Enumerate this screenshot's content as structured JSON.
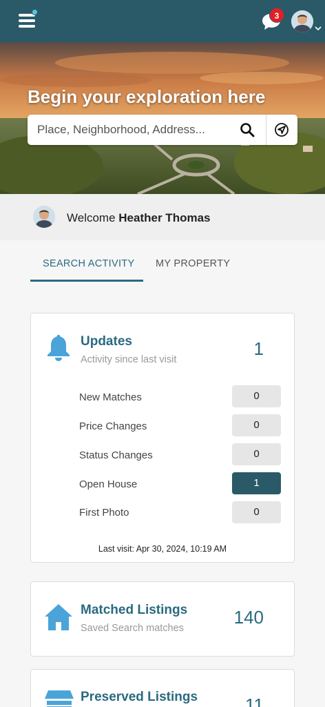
{
  "colors": {
    "header": "#2a5a68",
    "accent": "#2a6a80",
    "icon": "#4aa3d9",
    "badge": "#e41e26"
  },
  "header": {
    "menu_icon": "hamburger-icon",
    "chat_icon": "chat-bubble-icon",
    "notification_count": "3",
    "caret_icon": "chevron-down-icon"
  },
  "hero": {
    "title": "Begin your exploration here",
    "search_placeholder": "Place, Neighborhood, Address...",
    "search_icon": "search-icon",
    "locate_icon": "location-arrow-icon"
  },
  "welcome": {
    "greeting": "Welcome",
    "name": "Heather Thomas"
  },
  "tabs": [
    {
      "label": "SEARCH ACTIVITY",
      "active": true
    },
    {
      "label": "MY PROPERTY",
      "active": false
    }
  ],
  "updates": {
    "title": "Updates",
    "subtitle": "Activity since last visit",
    "count": "1",
    "icon": "bell-icon",
    "rows": [
      {
        "label": "New Matches",
        "value": "0"
      },
      {
        "label": "Price Changes",
        "value": "0"
      },
      {
        "label": "Status Changes",
        "value": "0"
      },
      {
        "label": "Open House",
        "value": "1"
      },
      {
        "label": "First Photo",
        "value": "0"
      }
    ],
    "last_visit": "Last visit: Apr 30, 2024, 10:19 AM"
  },
  "matched": {
    "title": "Matched Listings",
    "subtitle": "Saved Search matches",
    "count": "140",
    "icon": "house-icon"
  },
  "preserved": {
    "title": "Preserved Listings",
    "count": "11",
    "icon": "storefront-icon"
  }
}
